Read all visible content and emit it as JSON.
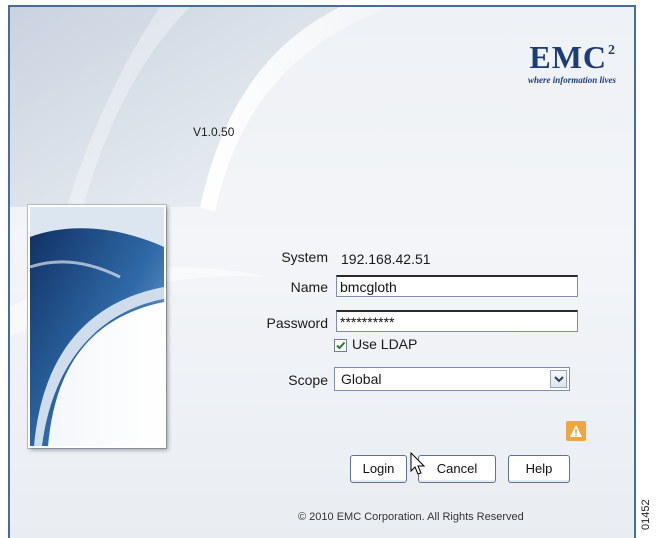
{
  "logo": {
    "main": "EMC",
    "superscript": "2",
    "tagline": "where information lives"
  },
  "version": "V1.0.50",
  "form": {
    "system_label": "System",
    "system_value": "192.168.42.51",
    "name_label": "Name",
    "name_value": "bmcgloth",
    "password_label": "Password",
    "password_value": "**********",
    "use_ldap_label": "Use LDAP",
    "use_ldap_checked": true,
    "scope_label": "Scope",
    "scope_value": "Global"
  },
  "buttons": {
    "login": "Login",
    "cancel": "Cancel",
    "help": "Help"
  },
  "warning_icon_color": "#f0a640",
  "copyright": "© 2010 EMC Corporation. All Rights Reserved",
  "figure_id": "01452",
  "colors": {
    "brand": "#1c3d78",
    "frame_border": "#4a6b9a"
  }
}
